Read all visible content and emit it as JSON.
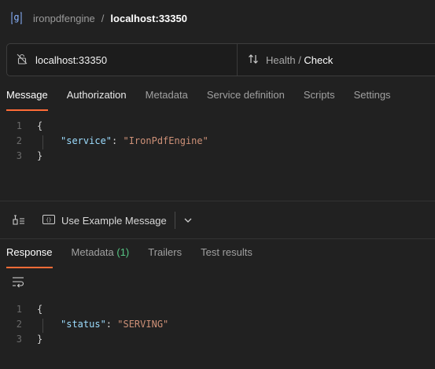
{
  "breadcrumb": {
    "icon": "grpc-icon",
    "parent": "ironpdfengine",
    "separator": "/",
    "current": "localhost:33350"
  },
  "urlbar": {
    "url": "localhost:33350",
    "method_service": "Health / ",
    "method_name": "Check"
  },
  "request_tabs": [
    {
      "label": "Message",
      "active": true
    },
    {
      "label": "Authorization",
      "active": false
    },
    {
      "label": "Metadata",
      "active": false
    },
    {
      "label": "Service definition",
      "active": false
    },
    {
      "label": "Scripts",
      "active": false
    },
    {
      "label": "Settings",
      "active": false
    }
  ],
  "message_editor": {
    "line_numbers": [
      "1",
      "2",
      "3"
    ],
    "open_brace": "{",
    "key": "\"service\"",
    "colon": ": ",
    "value": "\"IronPdfEngine\"",
    "close_brace": "}"
  },
  "toolbar": {
    "example_label": "Use Example Message"
  },
  "response_tabs": {
    "response": "Response",
    "metadata": "Metadata",
    "metadata_count": "(1)",
    "trailers": "Trailers",
    "test_results": "Test results"
  },
  "response_editor": {
    "line_numbers": [
      "1",
      "2",
      "3"
    ],
    "open_brace": "{",
    "key": "\"status\"",
    "colon": ": ",
    "value": "\"SERVING\"",
    "close_brace": "}"
  },
  "colors": {
    "accent": "#ff6c37",
    "background": "#212121",
    "json_key": "#9cdcfe",
    "json_string": "#ce9178",
    "badge": "#57c785"
  }
}
